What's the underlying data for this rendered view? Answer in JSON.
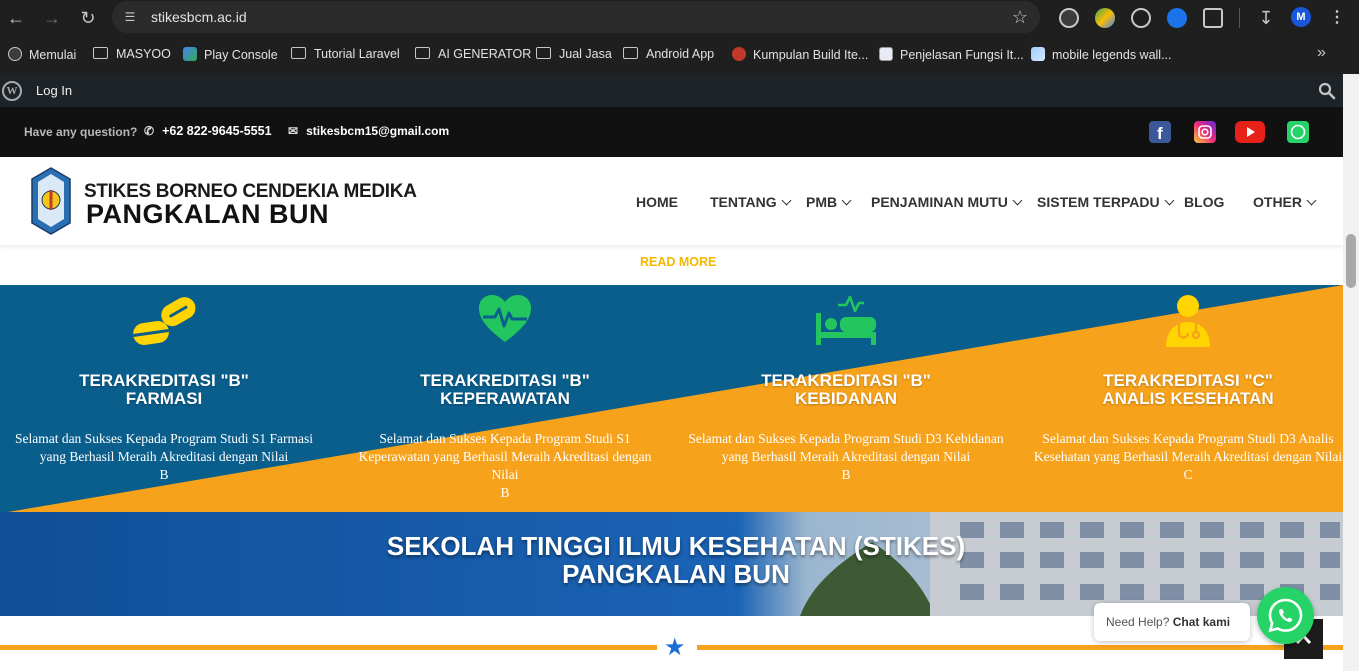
{
  "browser": {
    "url": "stikesbcm.ac.id",
    "profile_initial": "M",
    "bookmarks": [
      {
        "label": "Memulai",
        "icon": "wordpress-icon"
      },
      {
        "label": "MASYOO",
        "icon": "folder-icon"
      },
      {
        "label": "Play Console",
        "icon": "play-console-icon"
      },
      {
        "label": "Tutorial Laravel",
        "icon": "folder-icon"
      },
      {
        "label": "AI GENERATOR",
        "icon": "folder-icon"
      },
      {
        "label": "Jual Jasa",
        "icon": "folder-icon"
      },
      {
        "label": "Android App",
        "icon": "folder-icon"
      },
      {
        "label": "Kumpulan Build Ite...",
        "icon": "site-favicon"
      },
      {
        "label": "Penjelasan Fungsi It...",
        "icon": "site-favicon"
      },
      {
        "label": "mobile legends wall...",
        "icon": "image-favicon"
      }
    ]
  },
  "wpbar": {
    "login_label": "Log In"
  },
  "topbar": {
    "question": "Have any question?",
    "phone": "+62 822-9645-5551",
    "email": "stikesbcm15@gmail.com"
  },
  "header": {
    "brand_line1": "STIKES BORNEO CENDEKIA MEDIKA",
    "brand_line2": "PANGKALAN BUN",
    "menu": [
      "HOME",
      "TENTANG",
      "PMB",
      "PENJAMINAN MUTU",
      "SISTEM TERPADU",
      "BLOG",
      "OTHER"
    ]
  },
  "readmore_label": "READ MORE",
  "features": [
    {
      "title1": "TERAKREDITASI \"B\"",
      "title2": "FARMASI",
      "desc": "Selamat dan Sukses Kepada Program Studi S1 Farmasi yang Berhasil Meraih Akreditasi dengan Nilai",
      "grade": "B",
      "icon": "pills-icon"
    },
    {
      "title1": "TERAKREDITASI \"B\"",
      "title2": "KEPERAWATAN",
      "desc": "Selamat dan Sukses Kepada Program Studi S1 Keperawatan yang Berhasil Meraih Akreditasi dengan Nilai",
      "grade": "B",
      "icon": "heartbeat-icon"
    },
    {
      "title1": "TERAKREDITASI \"B\"",
      "title2": "KEBIDANAN",
      "desc": "Selamat dan Sukses Kepada Program Studi D3 Kebidanan yang Berhasil Meraih Akreditasi dengan Nilai",
      "grade": "B",
      "icon": "hospital-bed-icon"
    },
    {
      "title1": "TERAKREDITASI \"C\"",
      "title2": "ANALIS KESEHATAN",
      "desc": "Selamat dan Sukses Kepada Program Studi D3 Analis Kesehatan yang Berhasil Meraih Akreditasi dengan Nilai",
      "grade": "C",
      "icon": "doctor-icon"
    }
  ],
  "hero": {
    "line1": "SEKOLAH TINGGI ILMU KESEHATAN (STIKES)",
    "line2": "PANGKALAN BUN"
  },
  "chat": {
    "prefix": "Need Help?",
    "action": "Chat kami"
  },
  "colors": {
    "blue": "#0a5e8c",
    "orange": "#f7a21b",
    "yellow_icon": "#ffd400",
    "green_icon": "#22c55e",
    "hero_blue": "#14559e"
  }
}
